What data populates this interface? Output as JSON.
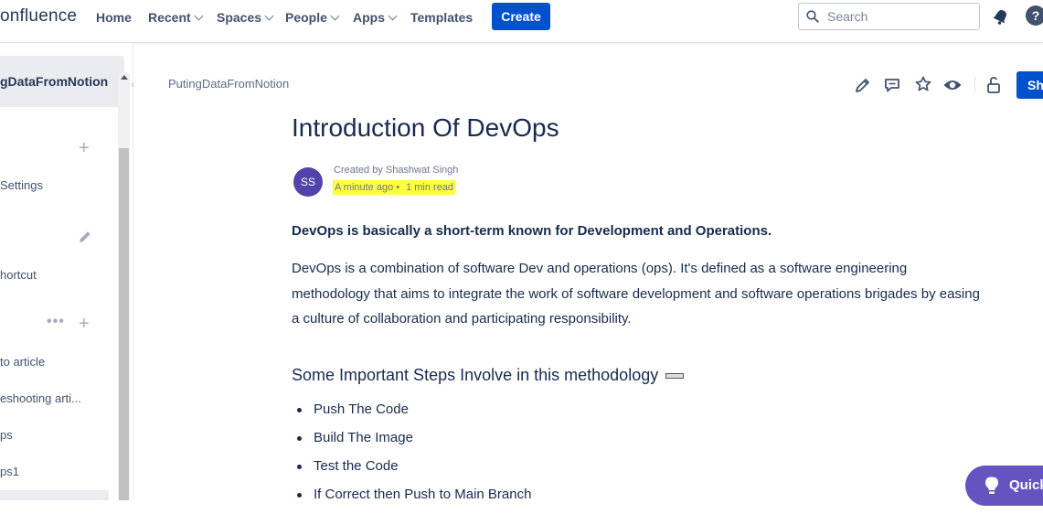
{
  "header": {
    "logo_text": "onfluence",
    "nav": {
      "home": "Home",
      "recent": "Recent",
      "spaces": "Spaces",
      "people": "People",
      "apps": "Apps",
      "templates": "Templates"
    },
    "create_label": "Create",
    "search_placeholder": "Search"
  },
  "sidebar": {
    "space_name": "gDataFromNotion",
    "items": [
      {
        "label": "Settings"
      },
      {
        "label": "hortcut"
      },
      {
        "label": "to article"
      },
      {
        "label": "eshooting arti..."
      },
      {
        "label": "ps"
      },
      {
        "label": "ps1"
      }
    ]
  },
  "page": {
    "breadcrumb": "PutingDataFromNotion",
    "share_label": "Sh",
    "title": "Introduction Of DevOps",
    "author_initials": "SS",
    "created_by": "Created by Shashwat Singh",
    "time_ago": "A minute ago",
    "read_time": "1 min read",
    "lead": "DevOps is basically a short-term known for Development and Operations.",
    "paragraph": "DevOps is a combination of software Dev and operations (ops). It's defined as a software engineering methodology that aims to integrate the work of software development and software operations brigades by easing a culture of collaboration and participating responsibility.",
    "heading": "Some Important Steps Involve in this methodology",
    "steps": [
      "Push The Code",
      "Build The Image",
      "Test the Code",
      "If Correct then Push to Main Branch"
    ]
  },
  "quick_help": "Quick"
}
